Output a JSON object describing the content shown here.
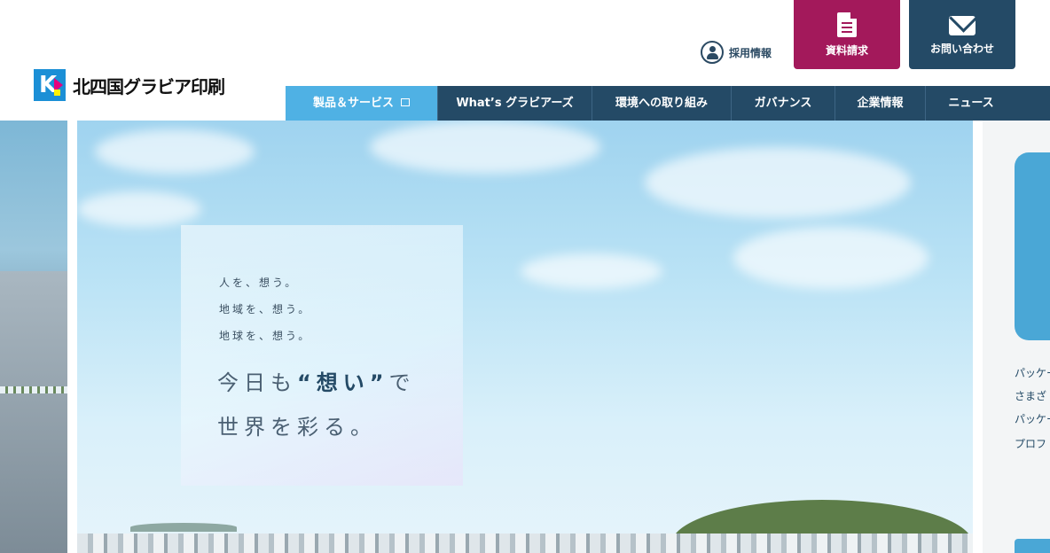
{
  "brand": {
    "logo_text": "北四国グラビア印刷",
    "logo_mark_letter": "K"
  },
  "header": {
    "recruit_label": "採用情報",
    "doc_request_label": "資料請求",
    "contact_label": "お問い合わせ"
  },
  "nav": {
    "items": [
      {
        "label": "製品＆サービス",
        "active": true
      },
      {
        "label": "What’s グラビアーズ",
        "active": false
      },
      {
        "label": "環境への取り組み",
        "active": false
      },
      {
        "label": "ガバナンス",
        "active": false
      },
      {
        "label": "企業情報",
        "active": false
      },
      {
        "label": "ニュース",
        "active": false
      }
    ]
  },
  "hero": {
    "line1": "人を、想う。",
    "line2": "地域を、想う。",
    "line3": "地球を、想う。",
    "headline_prefix": "今日も",
    "headline_emphasis": "“想い”",
    "headline_suffix": "で",
    "headline_line2": "世界を彩る。"
  },
  "side_panel": {
    "lines": [
      "パッケー",
      "さまざ",
      "パッケー",
      "プロフ"
    ]
  },
  "colors": {
    "nav_bg": "#244a66",
    "nav_active": "#4fb1e4",
    "doc_button": "#a3195b",
    "contact_button": "#244a66"
  },
  "icons": [
    "user-icon",
    "document-icon",
    "mail-icon",
    "window-icon"
  ]
}
